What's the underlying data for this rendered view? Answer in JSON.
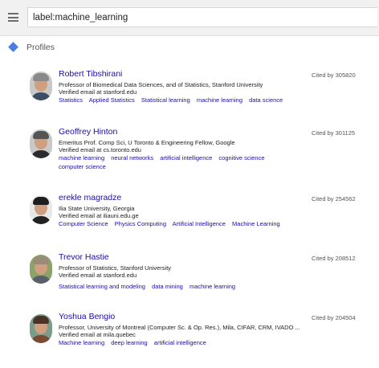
{
  "search": {
    "value": "label:machine_learning"
  },
  "section": {
    "title": "Profiles"
  },
  "profiles": [
    {
      "name": "Robert Tibshirani",
      "affiliation": "Professor of Biomedical Data Sciences, and of Statistics, Stanford University",
      "email": "Verified email at stanford.edu",
      "cited": "Cited by 305820",
      "tags": [
        "Statistics",
        "Applied Statistics",
        "Statistical learning",
        "machine learning",
        "data science"
      ]
    },
    {
      "name": "Geoffrey Hinton",
      "affiliation": "Emeritus Prof. Comp Sci, U Toronto & Engineering Fellow, Google",
      "email": "Verified email at cs.toronto.edu",
      "cited": "Cited by 301125",
      "tags": [
        "machine learning",
        "neural networks",
        "artificial intelligence",
        "cognitive science",
        "computer science"
      ]
    },
    {
      "name": "erekle magradze",
      "affiliation": "Ilia State University, Georgia",
      "email": "Verified email at iliauni.edu.ge",
      "cited": "Cited by 254562",
      "tags": [
        "Computer Science",
        "Physics Computing",
        "Artificial Intelligence",
        "Machine Learning"
      ]
    },
    {
      "name": "Trevor Hastie",
      "affiliation": "Professor of Statistics, Stanford University",
      "email": "Verified email at stanford.edu",
      "cited": "Cited by 208512",
      "tags": [
        "Statistical learning and modeling",
        "data mining",
        "machine learning"
      ]
    },
    {
      "name": "Yoshua Bengio",
      "affiliation": "Professor, University of Montreal (Computer Sc. & Op. Res.), Mila, CIFAR, CRM, IVADO ...",
      "email": "Verified email at mila.quebec",
      "cited": "Cited by 204504",
      "tags": [
        "Machine learning",
        "deep learning",
        "artificial intelligence"
      ]
    }
  ],
  "colors": {
    "link": "#1a0dab",
    "accent": "#4a7de0",
    "topbar": "#f1f1f1"
  },
  "icons": {
    "menu": "hamburger-menu-icon",
    "section": "diamond-icon"
  }
}
